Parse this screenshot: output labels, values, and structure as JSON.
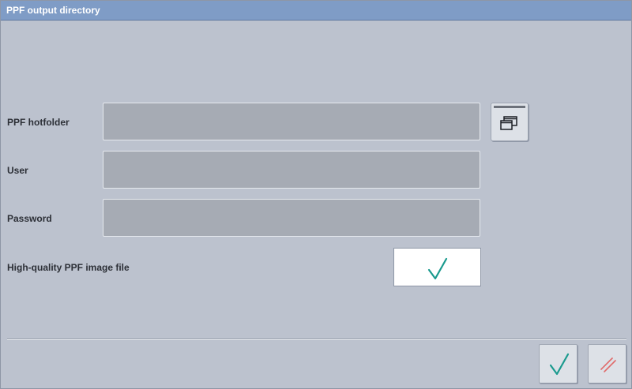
{
  "window": {
    "title": "PPF output directory"
  },
  "form": {
    "hotfolder": {
      "label": "PPF hotfolder",
      "value": ""
    },
    "user": {
      "label": "User",
      "value": ""
    },
    "password": {
      "label": "Password",
      "value": ""
    },
    "high_quality": {
      "label": "High-quality PPF image file",
      "checked": true
    }
  },
  "icons": {
    "browse": "browse-folder-icon",
    "check": "checkmark-icon",
    "confirm": "confirm-checkmark-icon",
    "cancel": "cancel-hatch-icon"
  },
  "colors": {
    "titlebar": "#7f9cc6",
    "background": "#bcc2ce",
    "field": "#a6abb4",
    "checkmark": "#1a9a8e",
    "cancel": "#e06a6a"
  }
}
